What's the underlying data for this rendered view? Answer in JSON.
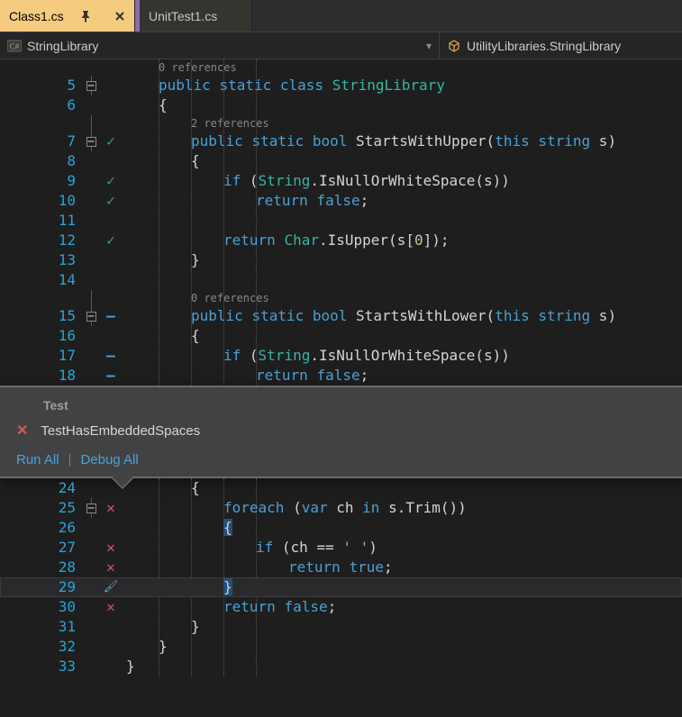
{
  "tabs": {
    "active": {
      "label": "Class1.cs"
    },
    "other": {
      "label": "UnitTest1.cs"
    }
  },
  "nav": {
    "left": "StringLibrary",
    "right": "UtilityLibraries.StringLibrary"
  },
  "popup": {
    "header": "Test",
    "test_name": "TestHasEmbeddedSpaces",
    "run_all": "Run All",
    "debug_all": "Debug All"
  },
  "code": {
    "upper": [
      {
        "n": "",
        "fold": "",
        "status": "",
        "kind": "ref",
        "indent": 1,
        "refs": "0 references"
      },
      {
        "n": "5",
        "fold": "box",
        "status": "",
        "kind": "code",
        "tokens": [
          [
            "",
            ""
          ],
          [
            "kw",
            "public"
          ],
          [
            "",
            " "
          ],
          [
            "kw",
            "static"
          ],
          [
            "",
            " "
          ],
          [
            "kw",
            "class"
          ],
          [
            "",
            " "
          ],
          [
            "type",
            "StringLibrary"
          ]
        ],
        "indent": 1
      },
      {
        "n": "6",
        "fold": "|",
        "status": "",
        "kind": "code",
        "tokens": [
          [
            "pun",
            "{"
          ]
        ],
        "indent": 1
      },
      {
        "n": "",
        "fold": "|",
        "status": "",
        "kind": "ref",
        "indent": 2,
        "refs": "2 references"
      },
      {
        "n": "7",
        "fold": "box",
        "status": "check",
        "kind": "code",
        "tokens": [
          [
            "kw",
            "public"
          ],
          [
            "",
            " "
          ],
          [
            "kw",
            "static"
          ],
          [
            "",
            " "
          ],
          [
            "kw",
            "bool"
          ],
          [
            "",
            " "
          ],
          [
            "id",
            "StartsWithUpper"
          ],
          [
            "pun",
            "("
          ],
          [
            "kw",
            "this"
          ],
          [
            "",
            " "
          ],
          [
            "kw",
            "string"
          ],
          [
            "",
            " "
          ],
          [
            "id",
            "s"
          ],
          [
            "pun",
            ")"
          ]
        ],
        "indent": 2
      },
      {
        "n": "8",
        "fold": "|",
        "status": "",
        "kind": "code",
        "tokens": [
          [
            "pun",
            "{"
          ]
        ],
        "indent": 2
      },
      {
        "n": "9",
        "fold": "|",
        "status": "check",
        "kind": "code",
        "tokens": [
          [
            "kw",
            "if"
          ],
          [
            "",
            " "
          ],
          [
            "pun",
            "("
          ],
          [
            "type",
            "String"
          ],
          [
            "pun",
            "."
          ],
          [
            "id",
            "IsNullOrWhiteSpace"
          ],
          [
            "pun",
            "("
          ],
          [
            "id",
            "s"
          ],
          [
            "pun",
            "))"
          ]
        ],
        "indent": 3
      },
      {
        "n": "10",
        "fold": "|",
        "status": "check",
        "kind": "code",
        "tokens": [
          [
            "kw",
            "return"
          ],
          [
            "",
            " "
          ],
          [
            "kw",
            "false"
          ],
          [
            "pun",
            ";"
          ]
        ],
        "indent": 4
      },
      {
        "n": "11",
        "fold": "|",
        "status": "",
        "kind": "code",
        "tokens": [],
        "indent": 0
      },
      {
        "n": "12",
        "fold": "|",
        "status": "check",
        "kind": "code",
        "tokens": [
          [
            "kw",
            "return"
          ],
          [
            "",
            " "
          ],
          [
            "type",
            "Char"
          ],
          [
            "pun",
            "."
          ],
          [
            "id",
            "IsUpper"
          ],
          [
            "pun",
            "("
          ],
          [
            "id",
            "s"
          ],
          [
            "pun",
            "["
          ],
          [
            "num",
            "0"
          ],
          [
            "pun",
            "]);"
          ]
        ],
        "indent": 3
      },
      {
        "n": "13",
        "fold": "|",
        "status": "",
        "kind": "code",
        "tokens": [
          [
            "pun",
            "}"
          ]
        ],
        "indent": 2
      },
      {
        "n": "14",
        "fold": "|",
        "status": "",
        "kind": "code",
        "tokens": [],
        "indent": 0
      },
      {
        "n": "",
        "fold": "|",
        "status": "",
        "kind": "ref",
        "indent": 2,
        "refs": "0 references"
      },
      {
        "n": "15",
        "fold": "box",
        "status": "dash",
        "kind": "code",
        "tokens": [
          [
            "kw",
            "public"
          ],
          [
            "",
            " "
          ],
          [
            "kw",
            "static"
          ],
          [
            "",
            " "
          ],
          [
            "kw",
            "bool"
          ],
          [
            "",
            " "
          ],
          [
            "id",
            "StartsWithLower"
          ],
          [
            "pun",
            "("
          ],
          [
            "kw",
            "this"
          ],
          [
            "",
            " "
          ],
          [
            "kw",
            "string"
          ],
          [
            "",
            " "
          ],
          [
            "id",
            "s"
          ],
          [
            "pun",
            ")"
          ]
        ],
        "indent": 2
      },
      {
        "n": "16",
        "fold": "|",
        "status": "",
        "kind": "code",
        "tokens": [
          [
            "pun",
            "{"
          ]
        ],
        "indent": 2
      },
      {
        "n": "17",
        "fold": "|",
        "status": "dash",
        "kind": "code",
        "tokens": [
          [
            "kw",
            "if"
          ],
          [
            "",
            " "
          ],
          [
            "pun",
            "("
          ],
          [
            "type",
            "String"
          ],
          [
            "pun",
            "."
          ],
          [
            "id",
            "IsNullOrWhiteSpace"
          ],
          [
            "pun",
            "("
          ],
          [
            "id",
            "s"
          ],
          [
            "pun",
            "))"
          ]
        ],
        "indent": 3
      },
      {
        "n": "18",
        "fold": "|",
        "status": "dash",
        "kind": "code",
        "tokens": [
          [
            "kw",
            "return"
          ],
          [
            "",
            " "
          ],
          [
            "kw",
            "false"
          ],
          [
            "pun",
            ";"
          ]
        ],
        "indent": 4
      }
    ],
    "lower": [
      {
        "n": "24",
        "fold": "|",
        "status": "",
        "kind": "code",
        "tokens": [
          [
            "pun",
            "{"
          ]
        ],
        "indent": 2
      },
      {
        "n": "25",
        "fold": "box",
        "status": "x",
        "kind": "code",
        "tokens": [
          [
            "kw",
            "foreach"
          ],
          [
            "",
            " "
          ],
          [
            "pun",
            "("
          ],
          [
            "kw",
            "var"
          ],
          [
            "",
            " "
          ],
          [
            "id",
            "ch"
          ],
          [
            "",
            " "
          ],
          [
            "kw",
            "in"
          ],
          [
            "",
            " "
          ],
          [
            "id",
            "s"
          ],
          [
            "pun",
            "."
          ],
          [
            "id",
            "Trim"
          ],
          [
            "pun",
            "())"
          ]
        ],
        "indent": 3
      },
      {
        "n": "26",
        "fold": "|",
        "status": "",
        "kind": "code",
        "tokens": [
          [
            "hlpun",
            "{"
          ]
        ],
        "indent": 3
      },
      {
        "n": "27",
        "fold": "|",
        "status": "x",
        "kind": "code",
        "tokens": [
          [
            "kw",
            "if"
          ],
          [
            "",
            " "
          ],
          [
            "pun",
            "("
          ],
          [
            "id",
            "ch"
          ],
          [
            "",
            " "
          ],
          [
            "pun",
            "=="
          ],
          [
            "",
            " "
          ],
          [
            "str",
            "' '"
          ],
          [
            "pun",
            ")"
          ]
        ],
        "indent": 4
      },
      {
        "n": "28",
        "fold": "|",
        "status": "x",
        "kind": "code",
        "tokens": [
          [
            "kw",
            "return"
          ],
          [
            "",
            " "
          ],
          [
            "kw",
            "true"
          ],
          [
            "pun",
            ";"
          ]
        ],
        "indent": 5
      },
      {
        "n": "29",
        "fold": "|",
        "status": "brush",
        "kind": "code",
        "tokens": [
          [
            "hlpun",
            "}"
          ]
        ],
        "indent": 3,
        "current": true
      },
      {
        "n": "30",
        "fold": "|",
        "status": "x",
        "kind": "code",
        "tokens": [
          [
            "kw",
            "return"
          ],
          [
            "",
            " "
          ],
          [
            "kw",
            "false"
          ],
          [
            "pun",
            ";"
          ]
        ],
        "indent": 3
      },
      {
        "n": "31",
        "fold": "|",
        "status": "",
        "kind": "code",
        "tokens": [
          [
            "pun",
            "}"
          ]
        ],
        "indent": 2
      },
      {
        "n": "32",
        "fold": "|",
        "status": "",
        "kind": "code",
        "tokens": [
          [
            "pun",
            "}"
          ]
        ],
        "indent": 1
      },
      {
        "n": "33",
        "fold": "",
        "status": "",
        "kind": "code",
        "tokens": [
          [
            "pun",
            "}"
          ]
        ],
        "indent": 0
      }
    ]
  }
}
